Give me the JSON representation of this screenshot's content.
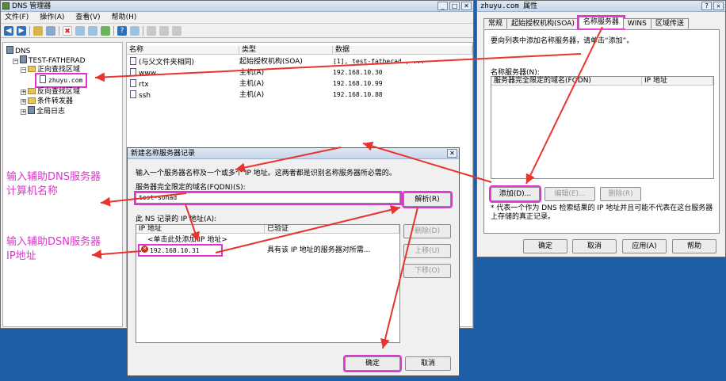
{
  "dns_manager": {
    "title": "DNS 管理器",
    "menu": [
      "文件(F)",
      "操作(A)",
      "查看(V)",
      "帮助(H)"
    ],
    "tree": {
      "root": "DNS",
      "server": "TEST-FATHERAD",
      "forward_zone": "正向查找区域",
      "zone": "zhuyu.com",
      "reverse_zone": "反向查找区域",
      "forwarders": "条件转发器",
      "global_logs": "全局日志"
    },
    "list_headers": [
      "名称",
      "类型",
      "数据"
    ],
    "records": [
      {
        "name": "(与父文件夹相同)",
        "type": "起始授权机构(SOA)",
        "data": "[1], test-fatherad., ..."
      },
      {
        "name": "www",
        "type": "主机(A)",
        "data": "192.168.10.30"
      },
      {
        "name": "rtx",
        "type": "主机(A)",
        "data": "192.168.10.99"
      },
      {
        "name": "ssh",
        "type": "主机(A)",
        "data": "192.168.10.88"
      }
    ]
  },
  "properties": {
    "title": "zhuyu.com 属性",
    "tabs": [
      "常规",
      "起始授权机构(SOA)",
      "名称服务器",
      "WINS",
      "区域传送"
    ],
    "hint": "要向列表中添加名称服务器，请单击“添加”。",
    "ns_label": "名称服务器(N):",
    "col_fqdn": "服务器完全限定的域名(FQDN)",
    "col_ip": "IP 地址",
    "btn_add": "添加(D)...",
    "btn_edit": "编辑(E)...",
    "btn_delete": "删除(R)",
    "note": "* 代表一个作为 DNS 检索结果的 IP 地址并且可能不代表在这台服务器上存储的真正记录。",
    "ok": "确定",
    "cancel": "取消",
    "apply": "应用(A)",
    "help": "帮助"
  },
  "new_ns_dialog": {
    "title": "新建名称服务器记录",
    "desc": "输入一个服务器名称及一个或多个 IP 地址。这两者都是识别名称服务器所必需的。",
    "fqdn_label": "服务器完全限定的域名(FQDN)(S):",
    "fqdn_value": "test-sonad",
    "resolve": "解析(R)",
    "ip_list_label": "此 NS 记录的 IP 地址(A):",
    "col_ip": "IP 地址",
    "col_verified": "已验证",
    "add_placeholder": "<单击此处添加 IP 地址>",
    "ip_entry": "192.168.10.31",
    "ip_status": "具有该 IP 地址的服务器对所需...",
    "btn_delete": "删除(D)",
    "btn_up": "上移(U)",
    "btn_down": "下移(O)",
    "ok": "确定",
    "cancel": "取消"
  },
  "annotations": {
    "dns_name": "输入辅助DNS服务器\n计算机名称",
    "ip_addr": "输入辅助DSN服务器\nIP地址"
  },
  "colors": {
    "highlight": "#e033d0",
    "arrow": "#e8332e",
    "desktop": "#1d5fa8"
  }
}
